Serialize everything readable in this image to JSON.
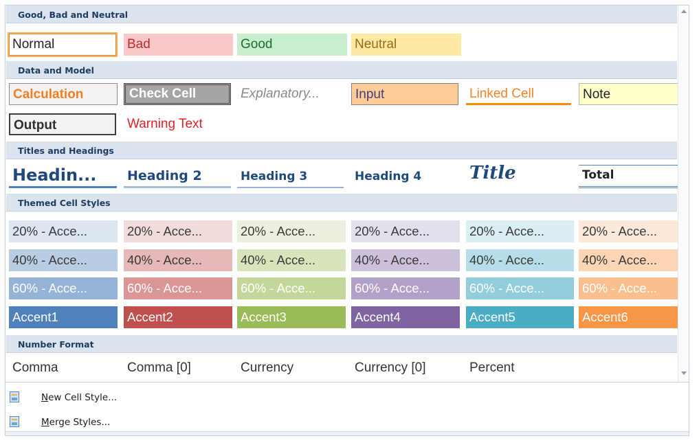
{
  "sections": {
    "good_bad": "Good, Bad and Neutral",
    "data_model": "Data and Model",
    "titles": "Titles and Headings",
    "themed": "Themed Cell Styles",
    "number": "Number Format"
  },
  "good_bad": {
    "normal": "Normal",
    "bad": "Bad",
    "good": "Good",
    "neutral": "Neutral"
  },
  "data_model": {
    "calculation": "Calculation",
    "check_cell": "Check Cell",
    "explanatory": "Explanatory...",
    "input": "Input",
    "linked_cell": "Linked Cell",
    "note": "Note",
    "output": "Output",
    "warning_text": "Warning Text"
  },
  "titles": {
    "heading1": "Headin...",
    "heading2": "Heading 2",
    "heading3": "Heading 3",
    "heading4": "Heading 4",
    "title": "Title",
    "total": "Total"
  },
  "themed": {
    "row20": [
      "20% - Acce...",
      "20% - Acce...",
      "20% - Acce...",
      "20% - Acce...",
      "20% - Acce...",
      "20% - Acce..."
    ],
    "row40": [
      "40% - Acce...",
      "40% - Acce...",
      "40% - Acce...",
      "40% - Acce...",
      "40% - Acce...",
      "40% - Acce..."
    ],
    "row60": [
      "60% - Acce...",
      "60% - Acce...",
      "60% - Acce...",
      "60% - Acce...",
      "60% - Acce...",
      "60% - Acce..."
    ],
    "accents": [
      "Accent1",
      "Accent2",
      "Accent3",
      "Accent4",
      "Accent5",
      "Accent6"
    ],
    "colors": {
      "accent_full": [
        "#4f81bd",
        "#c0504d",
        "#9bbb59",
        "#8064a2",
        "#4bacc6",
        "#f79646"
      ],
      "accent_60": [
        "#95b3d7",
        "#da9694",
        "#c4d79b",
        "#b1a0c7",
        "#92cddc",
        "#fabf8f"
      ],
      "accent_40": [
        "#b8cce4",
        "#e6b8b7",
        "#d8e4bc",
        "#ccc0da",
        "#b7dee8",
        "#fcd5b4"
      ],
      "accent_20": [
        "#dce6f1",
        "#f2dcdb",
        "#ebf1de",
        "#e4dfec",
        "#daeef3",
        "#fde9d9"
      ]
    }
  },
  "number": {
    "comma": "Comma",
    "comma0": "Comma [0]",
    "currency": "Currency",
    "currency0": "Currency [0]",
    "percent": "Percent"
  },
  "menu": {
    "new_cell_style": "New Cell Style...",
    "merge_styles": "Merge Styles..."
  },
  "icons": {
    "new_cell_style": "new-cell-style-icon",
    "merge_styles": "merge-styles-icon"
  }
}
